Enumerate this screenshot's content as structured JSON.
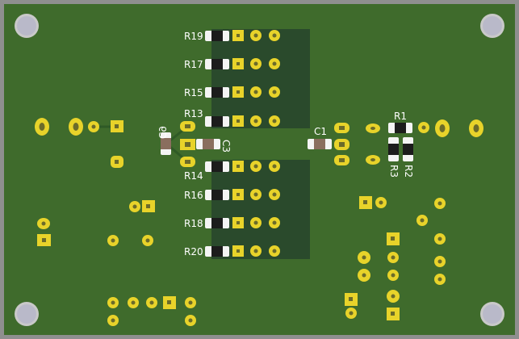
{
  "board": {
    "pcb_color": "#3f6b2c",
    "edge_color": "#8a8a8a",
    "pad_color": "#e8d32a",
    "copper_fill": "#2a4a2c",
    "silkscreen_color": "#ffffff"
  },
  "labels": {
    "r19": "R19",
    "r17": "R17",
    "r15": "R15",
    "r13": "R13",
    "r14": "R14",
    "r16": "R16",
    "r18": "R18",
    "r20": "R20",
    "c1": "C1",
    "c3": "C3",
    "c9": "C9",
    "r1": "R1",
    "r2": "R2",
    "r3": "R3"
  }
}
